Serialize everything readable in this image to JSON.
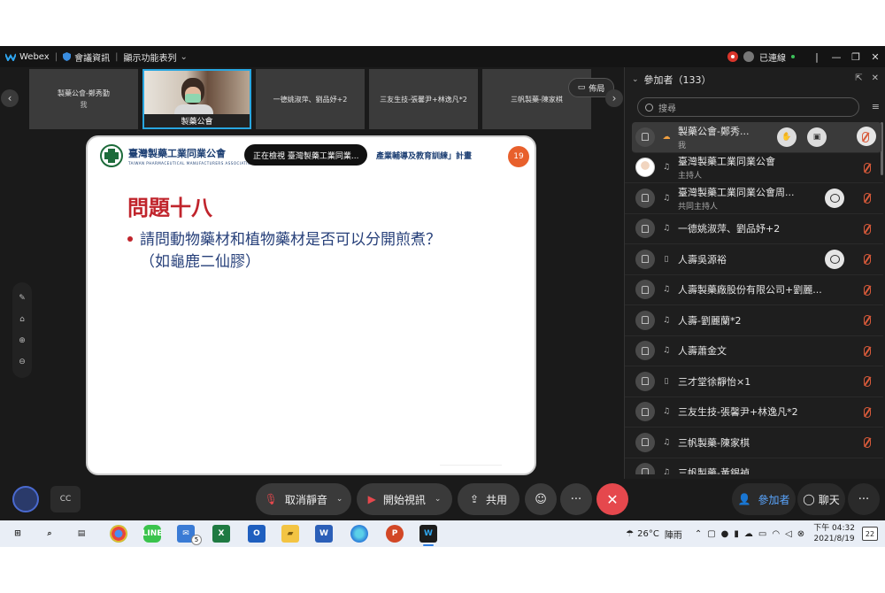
{
  "titlebar": {
    "app_name": "Webex",
    "meeting_info": "會議資訊",
    "show_menu": "顯示功能表列",
    "status": "已連線"
  },
  "strip": {
    "tiles": [
      {
        "name": "製藥公會-鄭秀勤",
        "sub": "我"
      },
      {
        "name": "製藥公會",
        "sub": ""
      },
      {
        "name": "一德姚淑萍、劉品妤+2",
        "sub": ""
      },
      {
        "name": "三友生技-張馨尹+林逸凡*2",
        "sub": ""
      },
      {
        "name": "三帆製藥-陳家棋",
        "sub": ""
      }
    ],
    "layout_label": "佈局"
  },
  "slide": {
    "assoc_name_zh": "臺灣製藥工業同業公會",
    "assoc_name_en": "TAIWAN PHARMACEUTICAL MANUFACTURERS ASSOCIATION",
    "viewing_text": "正在檢視 臺灣製藥工業同業...",
    "plan_text": "產業輔導及教育訓練」計畫",
    "page_number": "19",
    "title": "問題十八",
    "bullet_line1": "請問動物藥材和植物藥材是否可以分開煎煮？",
    "bullet_line2": "（如龜鹿二仙膠）"
  },
  "panel": {
    "title": "參加者（133）",
    "search_placeholder": "搜尋",
    "participants": [
      {
        "name": "製藥公會-鄭秀...",
        "role": "我"
      },
      {
        "name": "臺灣製藥工業同業公會",
        "role": "主持人"
      },
      {
        "name": "臺灣製藥工業同業公會周...",
        "role": "共同主持人"
      },
      {
        "name": "一德姚淑萍、劉品妤+2",
        "role": ""
      },
      {
        "name": "人壽吳源裕",
        "role": ""
      },
      {
        "name": "人壽製藥廠股份有限公司+劉麗...",
        "role": ""
      },
      {
        "name": "人壽-劉麗蘭*2",
        "role": ""
      },
      {
        "name": "人壽蕭金文",
        "role": ""
      },
      {
        "name": "三才堂徐靜怡×1",
        "role": ""
      },
      {
        "name": "三友生技-張馨尹+林逸凡*2",
        "role": ""
      },
      {
        "name": "三帆製藥-陳家棋",
        "role": ""
      },
      {
        "name": "三帆製藥-黃錫禎",
        "role": ""
      }
    ]
  },
  "controls": {
    "mute_label": "取消靜音",
    "video_label": "開始視訊",
    "share_label": "共用",
    "participants_label": "參加者",
    "chat_label": "聊天"
  },
  "taskbar": {
    "mail_badge": "5",
    "temperature": "26°C",
    "weather": "陣雨",
    "time": "下午 04:32",
    "date": "2021/8/19",
    "notifications": "22"
  },
  "colors": {
    "accent": "#28a6e0",
    "end_call": "#e5484d",
    "slide_title": "#c0242c",
    "slide_text": "#27407a",
    "mic_off": "#d95a3a"
  }
}
